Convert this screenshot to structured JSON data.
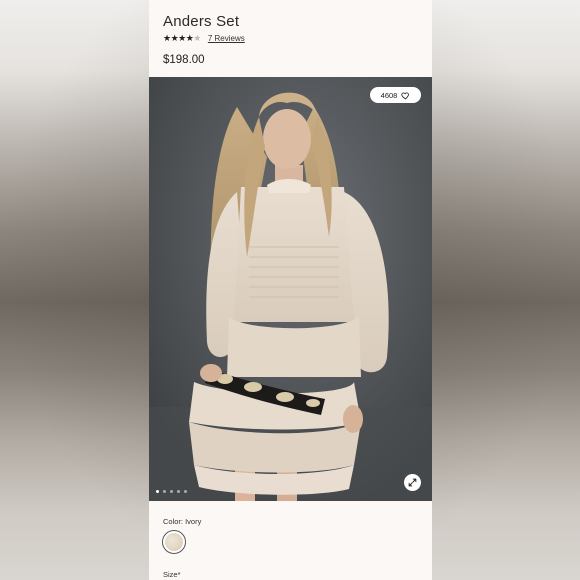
{
  "product": {
    "title": "Anders Set",
    "stars_filled": "★★★★",
    "stars_empty": "★",
    "rating": 4,
    "reviews_link": "7 Reviews",
    "price": "$198.00"
  },
  "gallery": {
    "likes": "4608",
    "like_icon": "heart-icon",
    "expand_icon": "expand-icon",
    "dots_count": 5,
    "active_dot": 1
  },
  "options": {
    "color_label": "Color: Ivory",
    "swatch_color": "#e4d9c7",
    "size_label": "Size*"
  },
  "colors": {
    "page_bg": "#fbf8f6",
    "photo_bg": "#525659"
  }
}
